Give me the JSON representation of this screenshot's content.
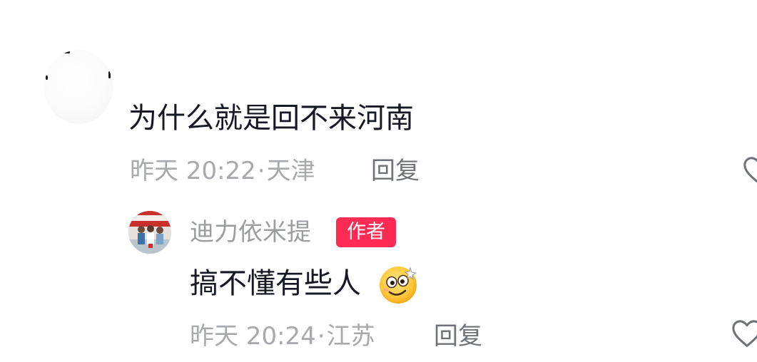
{
  "comment": {
    "text": "为什么就是回不来河南",
    "time": "昨天 20:22",
    "separator": "·",
    "location": "天津",
    "reply_label": "回复",
    "like_icon": "heart-outline-icon"
  },
  "author_reply": {
    "username": "迪力依米提",
    "badge": "作者",
    "text": "搞不懂有些人",
    "emoji_icon": "dizzy-smile-emoji-icon",
    "time": "昨天 20:24",
    "separator": "·",
    "location": "江苏",
    "reply_label": "回复",
    "like_icon": "heart-outline-icon"
  },
  "colors": {
    "primary_text": "#161823",
    "meta_text": "#a7a9ad",
    "author_badge": "#fe2c55"
  }
}
